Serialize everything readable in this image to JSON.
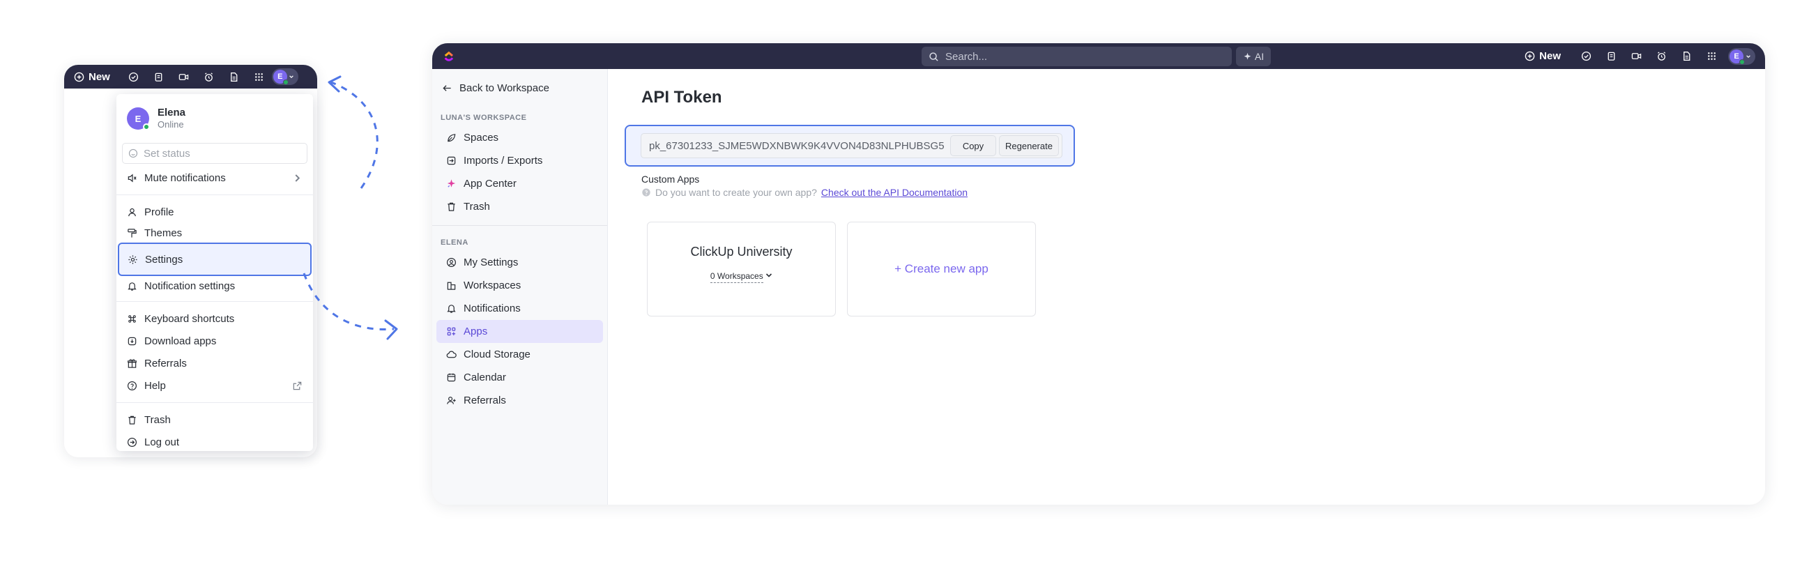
{
  "mini_window": {
    "new_label": "New",
    "avatar_initial": "E",
    "toolbar_icons": [
      "check-circle-icon",
      "clipboard-icon",
      "video-icon",
      "alarm-icon",
      "document-icon",
      "apps-grid-icon"
    ]
  },
  "dropdown": {
    "user": {
      "initial": "E",
      "name": "Elena",
      "status": "Online"
    },
    "set_status_placeholder": "Set status",
    "mute_notifications": "Mute notifications",
    "items_group1": [
      {
        "label": "Profile",
        "icon": "user-icon"
      },
      {
        "label": "Themes",
        "icon": "paint-roller-icon"
      },
      {
        "label": "Settings",
        "icon": "gear-icon",
        "highlighted": true
      },
      {
        "label": "Notification settings",
        "icon": "bell-icon"
      }
    ],
    "items_group2": [
      {
        "label": "Keyboard shortcuts",
        "icon": "command-icon"
      },
      {
        "label": "Download apps",
        "icon": "download-app-icon"
      },
      {
        "label": "Referrals",
        "icon": "gift-icon"
      },
      {
        "label": "Help",
        "icon": "help-circle-icon"
      }
    ],
    "items_group3": [
      {
        "label": "Trash",
        "icon": "trash-icon"
      },
      {
        "label": "Log out",
        "icon": "logout-icon"
      }
    ]
  },
  "topbar": {
    "search_placeholder": "Search...",
    "ai_label": "AI",
    "new_label": "New",
    "avatar_initial": "E"
  },
  "sidebar": {
    "back_label": "Back to Workspace",
    "workspace_section": "LUNA'S WORKSPACE",
    "workspace_items": [
      {
        "label": "Spaces",
        "icon": "spaces-icon"
      },
      {
        "label": "Imports / Exports",
        "icon": "import-icon"
      },
      {
        "label": "App Center",
        "icon": "app-center-icon"
      },
      {
        "label": "Trash",
        "icon": "trash-icon"
      }
    ],
    "user_section": "ELENA",
    "user_items": [
      {
        "label": "My Settings",
        "icon": "user-circle-icon"
      },
      {
        "label": "Workspaces",
        "icon": "workspaces-icon"
      },
      {
        "label": "Notifications",
        "icon": "bell-icon"
      },
      {
        "label": "Apps",
        "icon": "apps-icon",
        "active": true
      },
      {
        "label": "Cloud Storage",
        "icon": "cloud-icon"
      },
      {
        "label": "Calendar",
        "icon": "calendar-icon"
      },
      {
        "label": "Referrals",
        "icon": "user-plus-icon"
      }
    ]
  },
  "main": {
    "title": "API Token",
    "token": "pk_67301233_SJME5WDXNBWK9K4VVON4D83NLPHUBSG5",
    "copy_label": "Copy",
    "regenerate_label": "Regenerate",
    "custom_apps_label": "Custom Apps",
    "help_text": "Do you want to create your own app?",
    "help_link": "Check out the API Documentation",
    "app_card": {
      "title": "ClickUp University",
      "workspaces": "0 Workspaces"
    },
    "create_app_label": "+ Create new app"
  },
  "colors": {
    "topbar": "#2a2b45",
    "accent": "#7b68ee",
    "highlight_border": "#4f76e6",
    "highlight_fill": "#eef2ff",
    "online": "#27ae60"
  }
}
